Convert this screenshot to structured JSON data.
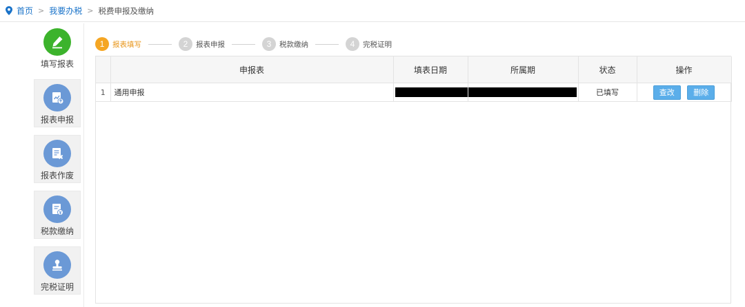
{
  "breadcrumb": {
    "home": "首页",
    "section": "我要办税",
    "current": "税费申报及缴纳",
    "separator": ">"
  },
  "sidebar": {
    "items": [
      {
        "label": "填写报表",
        "icon": "pencil-icon",
        "color": "#3cb32c",
        "active": true
      },
      {
        "label": "报表申报",
        "icon": "report-upload-icon",
        "color": "#6b99d6",
        "active": false
      },
      {
        "label": "报表作废",
        "icon": "report-cancel-icon",
        "color": "#6b99d6",
        "active": false
      },
      {
        "label": "税款缴纳",
        "icon": "tax-payment-icon",
        "color": "#6b99d6",
        "active": false
      },
      {
        "label": "完税证明",
        "icon": "stamp-icon",
        "color": "#6b99d6",
        "active": false
      }
    ]
  },
  "steps": [
    {
      "num": "1",
      "label": "报表填写",
      "active": true
    },
    {
      "num": "2",
      "label": "报表申报",
      "active": false
    },
    {
      "num": "3",
      "label": "税款缴纳",
      "active": false
    },
    {
      "num": "4",
      "label": "完税证明",
      "active": false
    }
  ],
  "table": {
    "columns": [
      "",
      "申报表",
      "填表日期",
      "所属期",
      "状态",
      "操作"
    ],
    "rows": [
      {
        "index": "1",
        "name": "通用申报",
        "fill_date": "",
        "period": "",
        "status": "已填写",
        "actions": [
          "查改",
          "删除"
        ]
      }
    ]
  },
  "colors": {
    "link": "#1a73c9",
    "active_step": "#f5a623",
    "button": "#5baeea"
  }
}
